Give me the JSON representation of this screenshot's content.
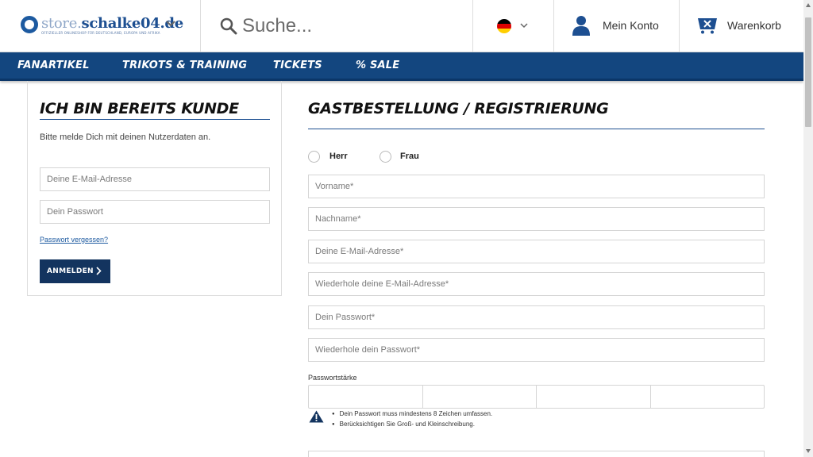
{
  "header": {
    "logo": {
      "prefix": "store.",
      "name": "schalke04.de",
      "tagline": "OFFIZIELLER ONLINESHOP FÜR DEUTSCHLAND, EUROPA UND AFRIKA"
    },
    "search": {
      "placeholder": "Suche..."
    },
    "language": {
      "flag": "de",
      "icon": "chevron-down-icon"
    },
    "account": {
      "label": "Mein Konto",
      "icon": "user-icon"
    },
    "cart": {
      "label": "Warenkorb",
      "icon": "cart-icon"
    }
  },
  "nav": {
    "items": [
      {
        "label": "FANARTIKEL"
      },
      {
        "label": "TRIKOTS & TRAINING"
      },
      {
        "label": "TICKETS"
      },
      {
        "label": "% SALE"
      }
    ]
  },
  "login": {
    "title": "ICH BIN BEREITS KUNDE",
    "hint": "Bitte melde Dich mit deinen Nutzerdaten an.",
    "email_placeholder": "Deine E-Mail-Adresse",
    "password_placeholder": "Dein Passwort",
    "forgot_label": "Passwort vergessen?",
    "submit_label": "ANMELDEN"
  },
  "register": {
    "title": "GASTBESTELLUNG / REGISTRIERUNG",
    "salutation": {
      "options": [
        "Herr",
        "Frau"
      ]
    },
    "fields": {
      "firstname": "Vorname*",
      "lastname": "Nachname*",
      "email": "Deine E-Mail-Adresse*",
      "email_repeat": "Wiederhole deine E-Mail-Adresse*",
      "password": "Dein Passwort*",
      "password_repeat": "Wiederhole dein Passwort*"
    },
    "password_strength_label": "Passwortstärke",
    "password_rules": [
      "Dein Passwort muss mindestens 8 Zeichen umfassen.",
      "Berücksichtigen Sie Groß- und Kleinschreibung."
    ]
  },
  "colors": {
    "brand_blue": "#13467f",
    "button_dark": "#13345f",
    "link_blue": "#1d5aa0"
  }
}
